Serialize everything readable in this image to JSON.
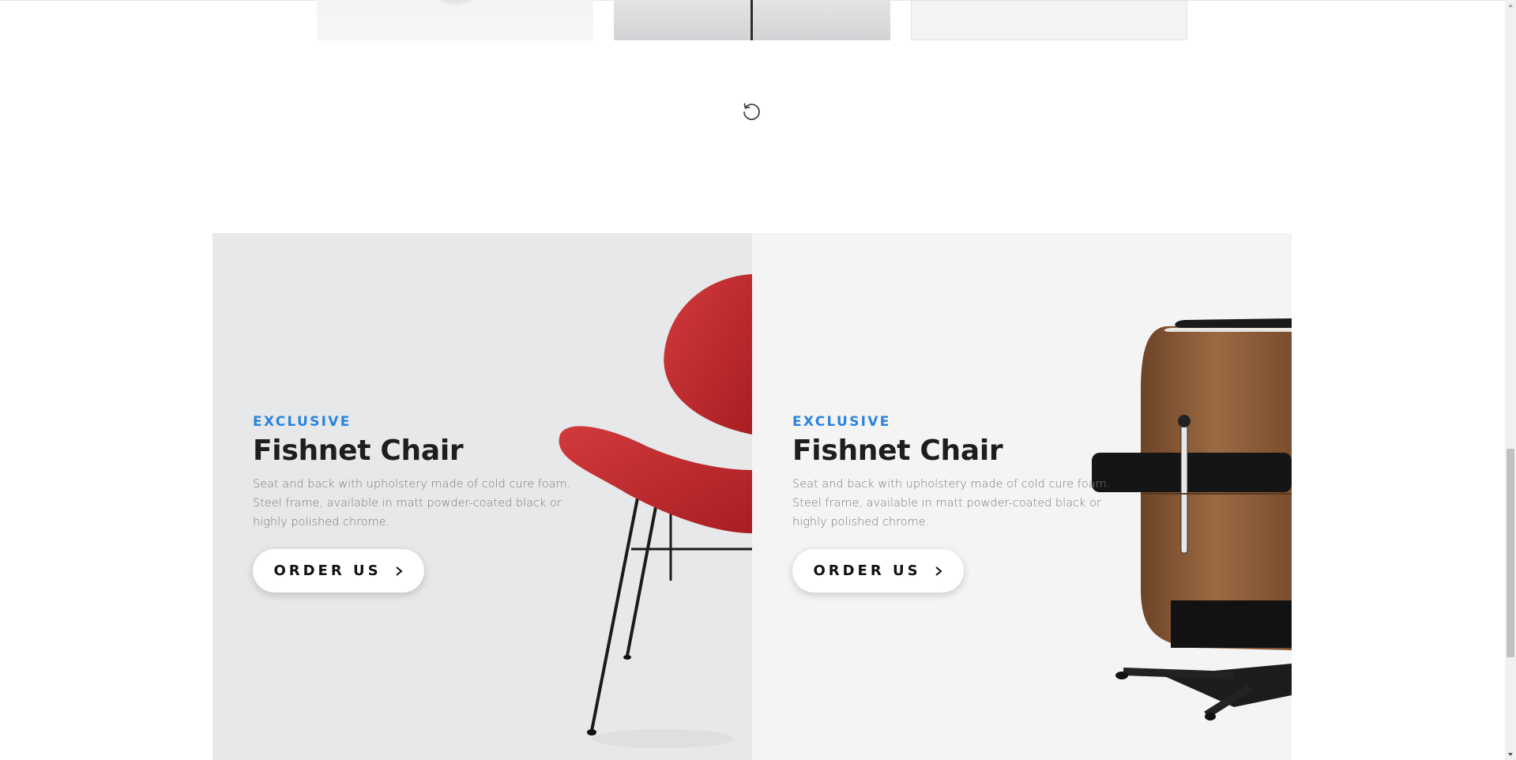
{
  "load_more": {
    "icon": "refresh-icon"
  },
  "banners": [
    {
      "eyebrow": "EXCLUSIVE",
      "title": "Fishnet Chair",
      "description": "Seat and back with upholstery made of cold cure foam. Steel frame, available in matt powder-coated black or highly polished chrome.",
      "button_label": "ORDER US",
      "button_icon": "chevron-right-icon"
    },
    {
      "eyebrow": "EXCLUSIVE",
      "title": "Fishnet Chair",
      "description": "Seat and back with upholstery made of cold cure foam. Steel frame, available in matt powder-coated black or highly polished chrome.",
      "button_label": "ORDER US",
      "button_icon": "chevron-right-icon"
    }
  ],
  "colors": {
    "accent": "#2a83de",
    "title": "#1e1e1e",
    "banner_left_bg": "#e7e8ea",
    "banner_right_bg": "#f4f4f4",
    "chair_red": "#c0282c",
    "chair_wood": "#8a5a35"
  }
}
